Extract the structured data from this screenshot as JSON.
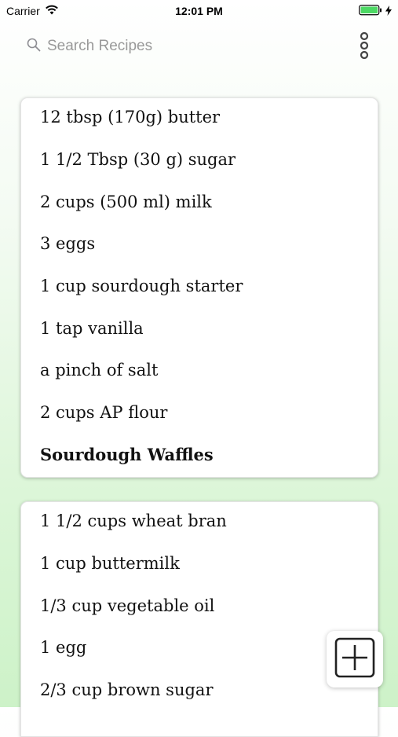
{
  "status_bar": {
    "carrier": "Carrier",
    "time": "12:01 PM"
  },
  "search": {
    "placeholder": "Search Recipes",
    "value": ""
  },
  "icons": {
    "search": "search-icon",
    "more": "more-vertical-icon",
    "add": "plus-square-icon",
    "wifi": "wifi-icon",
    "battery": "battery-icon"
  },
  "colors": {
    "background_top": "#ffffff",
    "background_bottom": "#cdf2c8",
    "card": "#ffffff"
  },
  "recipes": [
    {
      "lines": [
        "12 tbsp (170g) butter",
        "1 1/2 Tbsp (30 g) sugar",
        "2 cups (500 ml) milk",
        "3 eggs",
        "1 cup sourdough starter",
        "1 tap vanilla",
        "a pinch of salt",
        "2 cups AP flour"
      ],
      "title": "Sourdough Waffles"
    },
    {
      "lines": [
        "1 1/2 cups wheat bran",
        "1 cup buttermilk",
        "1/3 cup vegetable oil",
        "1 egg",
        "2/3 cup brown sugar"
      ]
    }
  ]
}
